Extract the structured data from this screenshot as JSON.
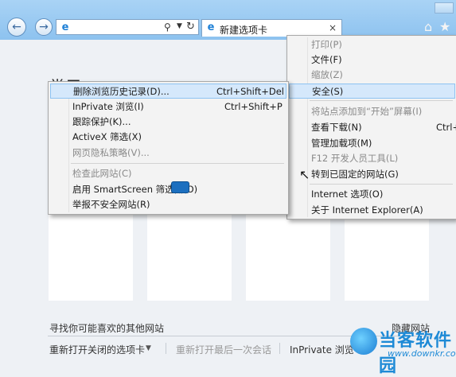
{
  "toolbar": {
    "back_glyph": "←",
    "forward_glyph": "→",
    "address_icons": {
      "logo": "ie-logo-icon",
      "search": "search-icon",
      "dropdown": "chevron-down-icon",
      "refresh": "refresh-icon"
    },
    "tab_title": "新建选项卡",
    "tab_close": "×",
    "home_icon": "home-icon",
    "favorites_icon": "star-icon"
  },
  "page": {
    "heading": "常用",
    "discover_text": "寻找你可能喜欢的其他网站",
    "hide_sites": "隐藏网站",
    "reopen_tabs": "重新打开关闭的选项卡",
    "reopen_last_session": "重新打开最后一次会话",
    "inprivate": "InPrivate 浏览"
  },
  "tools_menu": {
    "items": [
      {
        "label": "打印(P)",
        "disabled": true
      },
      {
        "label": "文件(F)",
        "disabled": false
      },
      {
        "label": "缩放(Z)",
        "disabled": true
      },
      {
        "label": "安全(S)",
        "disabled": false,
        "highlighted": true
      },
      {
        "label": "将站点添加到“开始”屏幕(I)",
        "disabled": true
      },
      {
        "label": "查看下载(N)",
        "shortcut": "Ctrl+",
        "disabled": false
      },
      {
        "label": "管理加载项(M)",
        "disabled": false
      },
      {
        "label": "F12 开发人员工具(L)",
        "disabled": true
      },
      {
        "label": "转到已固定的网站(G)",
        "disabled": false
      },
      {
        "label": "Internet 选项(O)",
        "disabled": false
      },
      {
        "label": "关于 Internet Explorer(A)",
        "disabled": false
      }
    ]
  },
  "safety_submenu": {
    "items": [
      {
        "label": "删除浏览历史记录(D)...",
        "shortcut": "Ctrl+Shift+Del",
        "highlighted": true
      },
      {
        "label": "InPrivate 浏览(I)",
        "shortcut": "Ctrl+Shift+P"
      },
      {
        "label": "跟踪保护(K)..."
      },
      {
        "label": "ActiveX 筛选(X)"
      },
      {
        "label": "网页隐私策略(V)...",
        "disabled": true
      },
      {
        "label": "检查此网站(C)",
        "disabled": true
      },
      {
        "label": "启用 SmartScreen 筛选器(O)"
      },
      {
        "label": "举报不安全网站(R)"
      }
    ]
  },
  "watermark": {
    "name": "当客软件园",
    "url": "www.downkr.com"
  }
}
